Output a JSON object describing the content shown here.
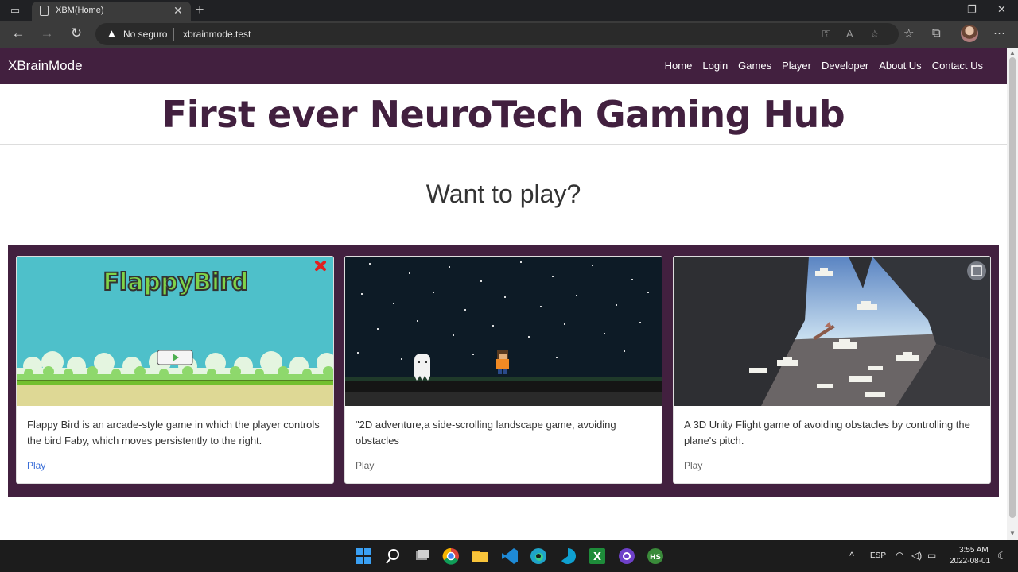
{
  "browser": {
    "tab_title": "XBM(Home)",
    "security_label": "No seguro",
    "url": "xbrainmode.test"
  },
  "site": {
    "brand": "XBrainMode",
    "nav": [
      "Home",
      "Login",
      "Games",
      "Player",
      "Developer",
      "About Us",
      "Contact Us"
    ],
    "headline": "First ever NeuroTech Gaming Hub",
    "subtitle": "Want to play?"
  },
  "games": [
    {
      "logo_text": "FlappyBird",
      "description": "Flappy Bird is an arcade-style game in which the player controls the bird Faby, which moves persistently to the right.",
      "play_label": "Play"
    },
    {
      "description": "\"2D adventure,a side-scrolling landscape game, avoiding obstacles",
      "play_label": "Play"
    },
    {
      "description": "A 3D Unity Flight game of avoiding obstacles by controlling the plane's pitch.",
      "play_label": "Play"
    }
  ],
  "taskbar": {
    "language": "ESP",
    "time": "3:55 AM",
    "date": "2022-08-01"
  },
  "colors": {
    "brand": "#42203f",
    "link": "#3a6ed8"
  },
  "icons": [
    "sidebar-icon",
    "page-icon",
    "close-icon",
    "plus-icon",
    "minimize-icon",
    "maximize-icon",
    "back-icon",
    "forward-icon",
    "refresh-icon",
    "warning-icon",
    "key-icon",
    "read-aloud-icon",
    "favorite-add-icon",
    "favorites-icon",
    "collections-icon",
    "more-icon"
  ]
}
